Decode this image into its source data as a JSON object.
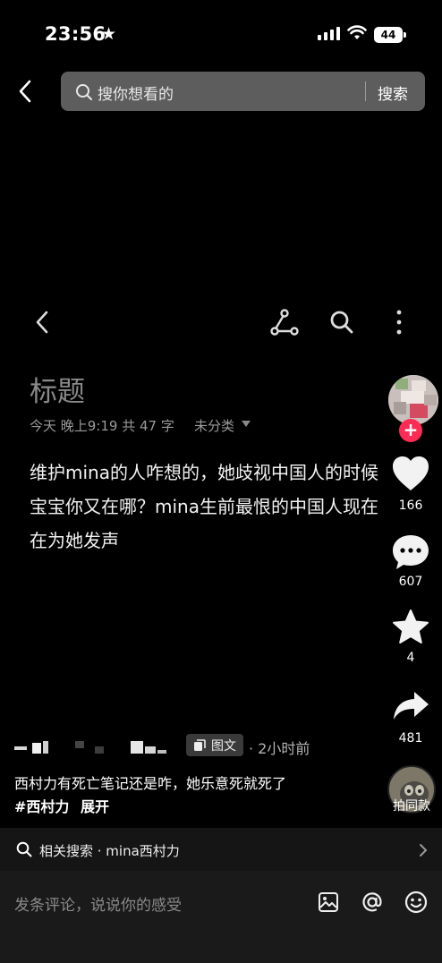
{
  "status_bar": {
    "time": "23:56",
    "battery": "44"
  },
  "search": {
    "placeholder": "搜你想看的",
    "button": "搜索"
  },
  "note": {
    "title": "标题",
    "meta": "今天 晚上9:19  共 47 字",
    "category": "未分类",
    "body_lines": [
      "维护mina的人咋想的，她歧视中国人的时候",
      "宝宝你又在哪？mina生前最恨的中国人现在",
      "在为她发声"
    ]
  },
  "rail": {
    "likes": "166",
    "comments": "607",
    "favorites": "4",
    "shares": "481",
    "music_label": "拍同款"
  },
  "post": {
    "type_badge": "图文",
    "time_ago": "· 2小时前",
    "description": "西村力有死亡笔记还是咋，她乐意死就死了",
    "hashtag": "#西村力",
    "expand": "展开"
  },
  "related": {
    "text": "相关搜索 · mina西村力"
  },
  "comment": {
    "placeholder": "发条评论，说说你的感受"
  },
  "colors": {
    "accent_red": "#fe2c55",
    "background": "#000000"
  }
}
